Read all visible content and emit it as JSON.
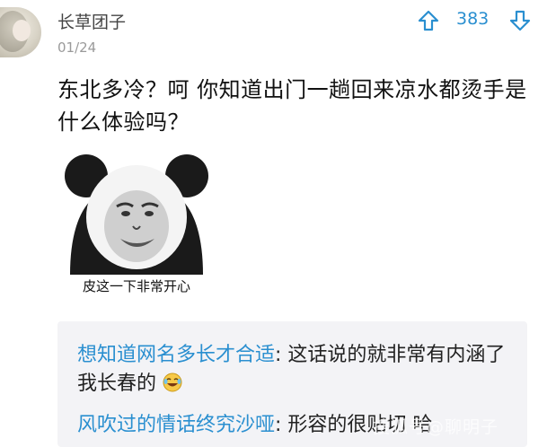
{
  "post": {
    "username": "长草团子",
    "date": "01/24",
    "score": "383",
    "text": "东北多冷？呵  你知道出门一趟回来凉水都烫手是什么体验吗？",
    "meme_caption": "皮这一下非常开心"
  },
  "comments": [
    {
      "author": "想知道网名多长才合适",
      "sep": ": ",
      "text": "这话说的就非常有内涵了 我长春的",
      "emoji": "laughing-tears-icon"
    },
    {
      "author": "风吹过的情话终究沙哑",
      "sep": ": ",
      "text": "形容的很贴切 哈"
    }
  ],
  "watermark": "搜狐号@聊明子",
  "colors": {
    "accent": "#2a8fd0",
    "comment_bg": "#f3f3f6"
  }
}
